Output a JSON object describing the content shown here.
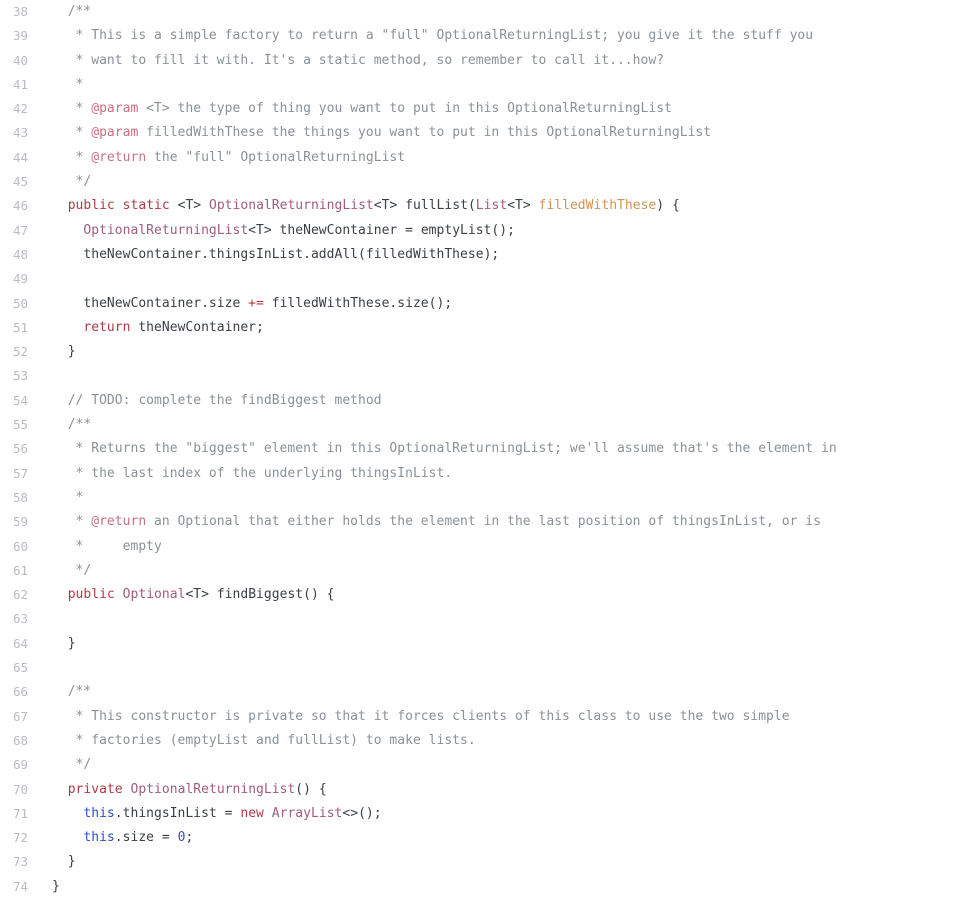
{
  "editor": {
    "language": "java",
    "first_line_number": 38,
    "last_line_number": 74,
    "background_color": "#ffffff",
    "gutter_color": "#b9bcc4",
    "colors": {
      "plain": "#3b4048",
      "comment": "#8a9199",
      "javadoc_tag": "#c9717f",
      "keyword": "#b03a48",
      "type": "#a35c7d",
      "parameter": "#cf9352",
      "this_keyword": "#2f4fc4",
      "number": "#2f4fc4",
      "operator": "#b03a48"
    }
  },
  "lines": [
    {
      "n": "38",
      "tokens": [
        {
          "t": "  /**",
          "c": "comment"
        }
      ]
    },
    {
      "n": "39",
      "tokens": [
        {
          "t": "   * This is a simple factory to return a \"full\" OptionalReturningList; you give it the stuff you",
          "c": "comment"
        }
      ]
    },
    {
      "n": "40",
      "tokens": [
        {
          "t": "   * want to fill it with. It's a static method, so remember to call it...how?",
          "c": "comment"
        }
      ]
    },
    {
      "n": "41",
      "tokens": [
        {
          "t": "   *",
          "c": "comment"
        }
      ]
    },
    {
      "n": "42",
      "tokens": [
        {
          "t": "   * ",
          "c": "comment"
        },
        {
          "t": "@param",
          "c": "javadoc_tag"
        },
        {
          "t": " <T> the type of thing you want to put in this OptionalReturningList",
          "c": "comment"
        }
      ]
    },
    {
      "n": "43",
      "tokens": [
        {
          "t": "   * ",
          "c": "comment"
        },
        {
          "t": "@param",
          "c": "javadoc_tag"
        },
        {
          "t": " filledWithThese the things you want to put in this OptionalReturningList",
          "c": "comment"
        }
      ]
    },
    {
      "n": "44",
      "tokens": [
        {
          "t": "   * ",
          "c": "comment"
        },
        {
          "t": "@return",
          "c": "javadoc_tag"
        },
        {
          "t": " the \"full\" OptionalReturningList",
          "c": "comment"
        }
      ]
    },
    {
      "n": "45",
      "tokens": [
        {
          "t": "   */",
          "c": "comment"
        }
      ]
    },
    {
      "n": "46",
      "tokens": [
        {
          "t": "  ",
          "c": "plain"
        },
        {
          "t": "public",
          "c": "keyword"
        },
        {
          "t": " ",
          "c": "plain"
        },
        {
          "t": "static",
          "c": "keyword"
        },
        {
          "t": " <T> ",
          "c": "plain"
        },
        {
          "t": "OptionalReturningList",
          "c": "type"
        },
        {
          "t": "<T> ",
          "c": "plain"
        },
        {
          "t": "fullList",
          "c": "plain"
        },
        {
          "t": "(",
          "c": "plain"
        },
        {
          "t": "List",
          "c": "type"
        },
        {
          "t": "<T> ",
          "c": "plain"
        },
        {
          "t": "filledWithThese",
          "c": "parameter"
        },
        {
          "t": ") {",
          "c": "plain"
        }
      ]
    },
    {
      "n": "47",
      "tokens": [
        {
          "t": "    ",
          "c": "plain"
        },
        {
          "t": "OptionalReturningList",
          "c": "type"
        },
        {
          "t": "<T> theNewContainer ",
          "c": "plain"
        },
        {
          "t": "=",
          "c": "plain"
        },
        {
          "t": " emptyList();",
          "c": "plain"
        }
      ]
    },
    {
      "n": "48",
      "tokens": [
        {
          "t": "    theNewContainer.thingsInList.addAll(filledWithThese);",
          "c": "plain"
        }
      ]
    },
    {
      "n": "49",
      "tokens": [
        {
          "t": "",
          "c": "plain"
        }
      ]
    },
    {
      "n": "50",
      "tokens": [
        {
          "t": "    theNewContainer.size ",
          "c": "plain"
        },
        {
          "t": "+=",
          "c": "operator"
        },
        {
          "t": " filledWithThese.size();",
          "c": "plain"
        }
      ]
    },
    {
      "n": "51",
      "tokens": [
        {
          "t": "    ",
          "c": "plain"
        },
        {
          "t": "return",
          "c": "keyword"
        },
        {
          "t": " theNewContainer;",
          "c": "plain"
        }
      ]
    },
    {
      "n": "52",
      "tokens": [
        {
          "t": "  }",
          "c": "plain"
        }
      ]
    },
    {
      "n": "53",
      "tokens": [
        {
          "t": "",
          "c": "plain"
        }
      ]
    },
    {
      "n": "54",
      "tokens": [
        {
          "t": "  // TODO: complete the findBiggest method",
          "c": "comment"
        }
      ]
    },
    {
      "n": "55",
      "tokens": [
        {
          "t": "  /**",
          "c": "comment"
        }
      ]
    },
    {
      "n": "56",
      "tokens": [
        {
          "t": "   * Returns the \"biggest\" element in this OptionalReturningList; we'll assume that's the element in",
          "c": "comment"
        }
      ]
    },
    {
      "n": "57",
      "tokens": [
        {
          "t": "   * the last index of the underlying thingsInList.",
          "c": "comment"
        }
      ]
    },
    {
      "n": "58",
      "tokens": [
        {
          "t": "   *",
          "c": "comment"
        }
      ]
    },
    {
      "n": "59",
      "tokens": [
        {
          "t": "   * ",
          "c": "comment"
        },
        {
          "t": "@return",
          "c": "javadoc_tag"
        },
        {
          "t": " an Optional that either holds the element in the last position of thingsInList, or is",
          "c": "comment"
        }
      ]
    },
    {
      "n": "60",
      "tokens": [
        {
          "t": "   *     empty",
          "c": "comment"
        }
      ]
    },
    {
      "n": "61",
      "tokens": [
        {
          "t": "   */",
          "c": "comment"
        }
      ]
    },
    {
      "n": "62",
      "tokens": [
        {
          "t": "  ",
          "c": "plain"
        },
        {
          "t": "public",
          "c": "keyword"
        },
        {
          "t": " ",
          "c": "plain"
        },
        {
          "t": "Optional",
          "c": "type"
        },
        {
          "t": "<T> findBiggest() {",
          "c": "plain"
        }
      ]
    },
    {
      "n": "63",
      "tokens": [
        {
          "t": "",
          "c": "plain"
        }
      ]
    },
    {
      "n": "64",
      "tokens": [
        {
          "t": "  }",
          "c": "plain"
        }
      ]
    },
    {
      "n": "65",
      "tokens": [
        {
          "t": "",
          "c": "plain"
        }
      ]
    },
    {
      "n": "66",
      "tokens": [
        {
          "t": "  /**",
          "c": "comment"
        }
      ]
    },
    {
      "n": "67",
      "tokens": [
        {
          "t": "   * This constructor is private so that it forces clients of this class to use the two simple",
          "c": "comment"
        }
      ]
    },
    {
      "n": "68",
      "tokens": [
        {
          "t": "   * factories (emptyList and fullList) to make lists.",
          "c": "comment"
        }
      ]
    },
    {
      "n": "69",
      "tokens": [
        {
          "t": "   */",
          "c": "comment"
        }
      ]
    },
    {
      "n": "70",
      "tokens": [
        {
          "t": "  ",
          "c": "plain"
        },
        {
          "t": "private",
          "c": "keyword"
        },
        {
          "t": " ",
          "c": "plain"
        },
        {
          "t": "OptionalReturningList",
          "c": "type"
        },
        {
          "t": "() {",
          "c": "plain"
        }
      ]
    },
    {
      "n": "71",
      "tokens": [
        {
          "t": "    ",
          "c": "plain"
        },
        {
          "t": "this",
          "c": "this_keyword"
        },
        {
          "t": ".thingsInList ",
          "c": "plain"
        },
        {
          "t": "=",
          "c": "plain"
        },
        {
          "t": " ",
          "c": "plain"
        },
        {
          "t": "new",
          "c": "keyword"
        },
        {
          "t": " ",
          "c": "plain"
        },
        {
          "t": "ArrayList",
          "c": "type"
        },
        {
          "t": "<>();",
          "c": "plain"
        }
      ]
    },
    {
      "n": "72",
      "tokens": [
        {
          "t": "    ",
          "c": "plain"
        },
        {
          "t": "this",
          "c": "this_keyword"
        },
        {
          "t": ".size ",
          "c": "plain"
        },
        {
          "t": "=",
          "c": "plain"
        },
        {
          "t": " ",
          "c": "plain"
        },
        {
          "t": "0",
          "c": "number"
        },
        {
          "t": ";",
          "c": "plain"
        }
      ]
    },
    {
      "n": "73",
      "tokens": [
        {
          "t": "  }",
          "c": "plain"
        }
      ]
    },
    {
      "n": "74",
      "tokens": [
        {
          "t": "}",
          "c": "plain"
        }
      ]
    }
  ]
}
